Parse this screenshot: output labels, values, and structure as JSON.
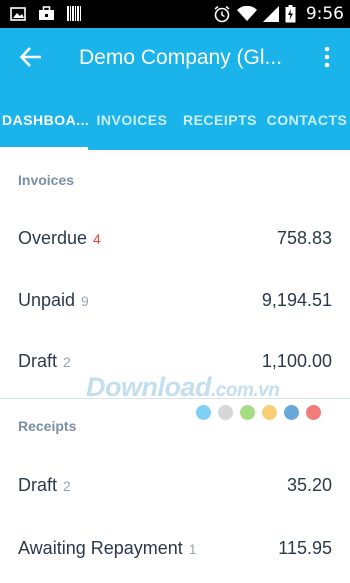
{
  "status_bar": {
    "time": "9:56",
    "icons": [
      "image-icon",
      "briefcase-icon",
      "barcode-icon",
      "alarm-icon",
      "wifi-icon",
      "signal-icon",
      "battery-icon"
    ]
  },
  "app_bar": {
    "title": "Demo Company (Gl...",
    "back_icon": "arrow-left-icon",
    "menu_icon": "more-vert-icon",
    "color": "#1ab4ea"
  },
  "tabs": [
    {
      "label": "DASHBOA...",
      "active": true
    },
    {
      "label": "INVOICES",
      "active": false
    },
    {
      "label": "RECEIPTS",
      "active": false
    },
    {
      "label": "CONTACTS",
      "active": false
    }
  ],
  "invoices": {
    "header": "Invoices",
    "rows": [
      {
        "label": "Overdue",
        "count": "4",
        "amount": "758.83"
      },
      {
        "label": "Unpaid",
        "count": "9",
        "amount": "9,194.51"
      },
      {
        "label": "Draft",
        "count": "2",
        "amount": "1,100.00"
      }
    ]
  },
  "receipts": {
    "header": "Receipts",
    "rows": [
      {
        "label": "Draft",
        "count": "2",
        "amount": "35.20"
      },
      {
        "label": "Awaiting Repayment",
        "count": "1",
        "amount": "115.95"
      }
    ]
  },
  "watermark": {
    "text": "Download",
    "suffix": ".com.vn",
    "dot_colors": [
      "#7fd0f5",
      "#d7d7d7",
      "#a6dc86",
      "#f8cf77",
      "#6aa8dc",
      "#f27b7b"
    ]
  }
}
